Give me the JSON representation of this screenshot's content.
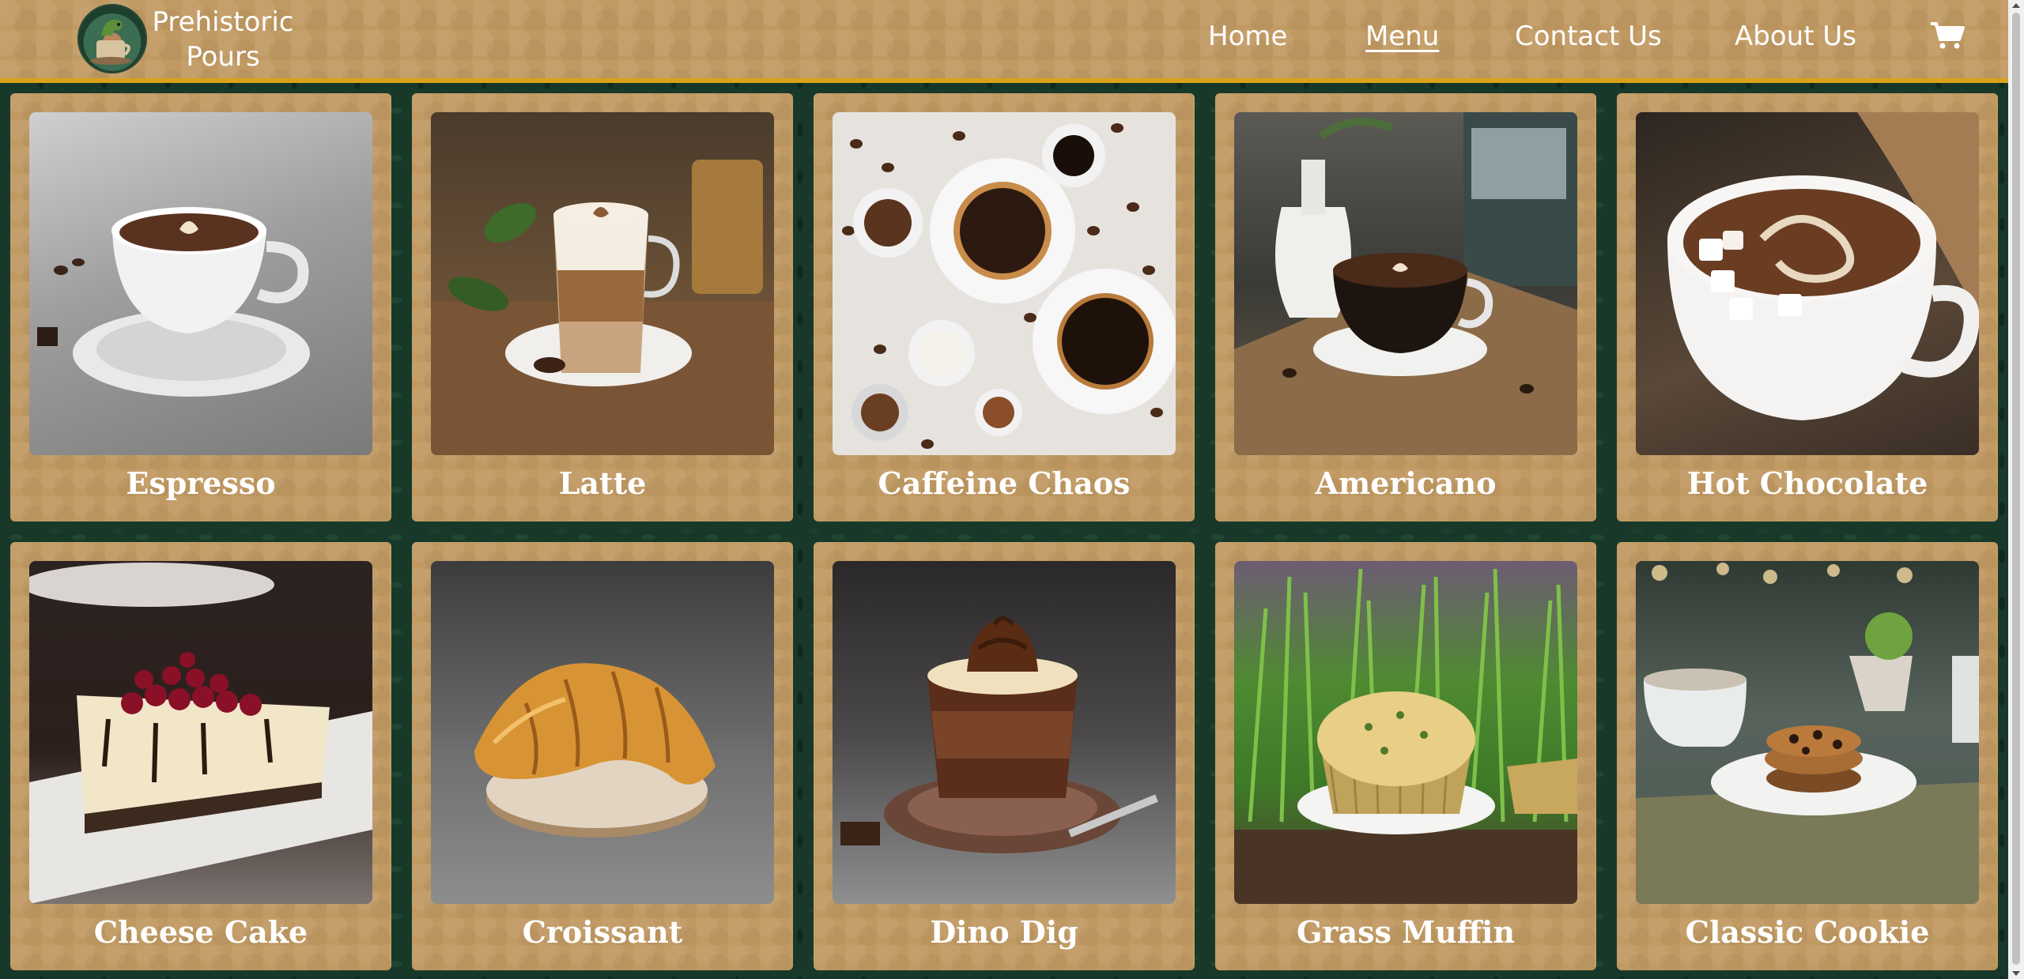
{
  "brand": {
    "line1": "Prehistoric",
    "line2": "Pours",
    "logo_icon": "dino-coffee-logo-icon"
  },
  "nav": [
    {
      "label": "Home",
      "active": false
    },
    {
      "label": "Menu",
      "active": true
    },
    {
      "label": "Contact Us",
      "active": false
    },
    {
      "label": "About Us",
      "active": false
    }
  ],
  "cart": {
    "icon": "cart-icon",
    "count": ""
  },
  "menu_items": [
    {
      "name": "Espresso",
      "image": "espresso-photo"
    },
    {
      "name": "Latte",
      "image": "latte-photo"
    },
    {
      "name": "Caffeine Chaos",
      "image": "caffeine-chaos-photo"
    },
    {
      "name": "Americano",
      "image": "americano-photo"
    },
    {
      "name": "Hot Chocolate",
      "image": "hot-chocolate-photo"
    },
    {
      "name": "Cheese Cake",
      "image": "cheese-cake-photo"
    },
    {
      "name": "Croissant",
      "image": "croissant-photo"
    },
    {
      "name": "Dino Dig",
      "image": "dino-dig-photo"
    },
    {
      "name": "Grass Muffin",
      "image": "grass-muffin-photo"
    },
    {
      "name": "Classic Cookie",
      "image": "classic-cookie-photo"
    }
  ],
  "colors": {
    "header_bg": "#c19a63",
    "header_border": "#d9a21b",
    "page_bg": "#18392a",
    "card_bg": "#c19a63",
    "text": "#ffffff"
  }
}
